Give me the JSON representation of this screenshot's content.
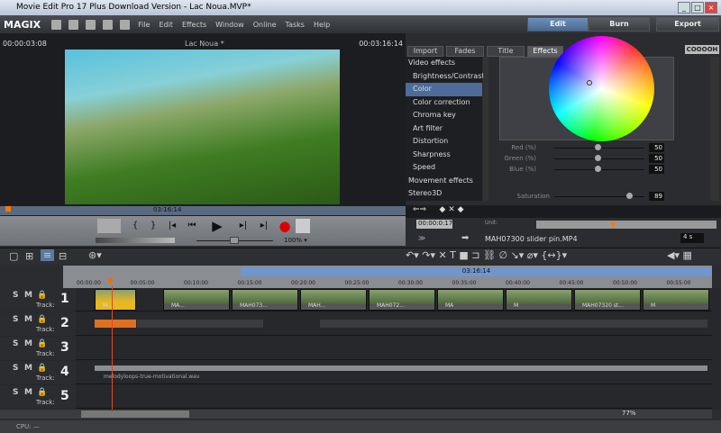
{
  "window": {
    "title": "Movie Edit Pro 17 Plus Download Version - Lac Noua.MVP*"
  },
  "menubar": {
    "logo": "MAGIX",
    "items": [
      "File",
      "Edit",
      "Effects",
      "Window",
      "Online",
      "Tasks",
      "Help"
    ],
    "modes": {
      "edit": "Edit",
      "burn": "Burn",
      "export": "Export"
    }
  },
  "preview": {
    "timecode_left": "00:00:03:08",
    "title": "Lac Noua *",
    "timecode_right": "00:03:16:14",
    "range_label": "03:16:14",
    "zoom": "100% ▾"
  },
  "effects": {
    "tabs": [
      "Import",
      "Fades",
      "Title",
      "Effects"
    ],
    "active_tab": "Effects",
    "brand": "COOOOH",
    "list": [
      {
        "label": "Video effects",
        "cat": true
      },
      {
        "label": "Brightness/Contrast"
      },
      {
        "label": "Color",
        "selected": true
      },
      {
        "label": "Color correction"
      },
      {
        "label": "Chroma key"
      },
      {
        "label": "Art filter"
      },
      {
        "label": "Distortion"
      },
      {
        "label": "Sharpness"
      },
      {
        "label": "Speed"
      },
      {
        "label": "Movement effects",
        "cat": true
      },
      {
        "label": "Stereo3D",
        "cat": true
      }
    ],
    "sliders": [
      {
        "label": "Red (%)",
        "value": "50"
      },
      {
        "label": "Green (%)",
        "value": "50"
      },
      {
        "label": "Blue (%)",
        "value": "50"
      }
    ],
    "saturation": {
      "label": "Saturation",
      "value": "89"
    },
    "keyframe_time": "00:00:0:17",
    "unit_label": "Unit:",
    "clip_name": "MAH07300 slider pin.MP4",
    "duration": "4 s"
  },
  "timeline": {
    "range_label": "03:16:14",
    "ticks": [
      "00:00:00",
      "00:05:00",
      "00:10:00",
      "00:15:00",
      "00:20:00",
      "00:25:00",
      "00:30:00",
      "00:35:00",
      "00:40:00",
      "00:45:00",
      "00:50:00",
      "00:55:00"
    ],
    "track_label": "Track:",
    "tracks": [
      "1",
      "2",
      "3",
      "4",
      "5"
    ],
    "clips1": [
      "M...",
      "MA...",
      "MAH073...",
      "MAH...",
      "MAH072...",
      "MA",
      "M",
      "MAH07320 st...",
      "M"
    ],
    "audio_clip": "melodyloops-true-motivational.wav",
    "zoom": "77%"
  },
  "status": {
    "cpu": "CPU: —"
  }
}
